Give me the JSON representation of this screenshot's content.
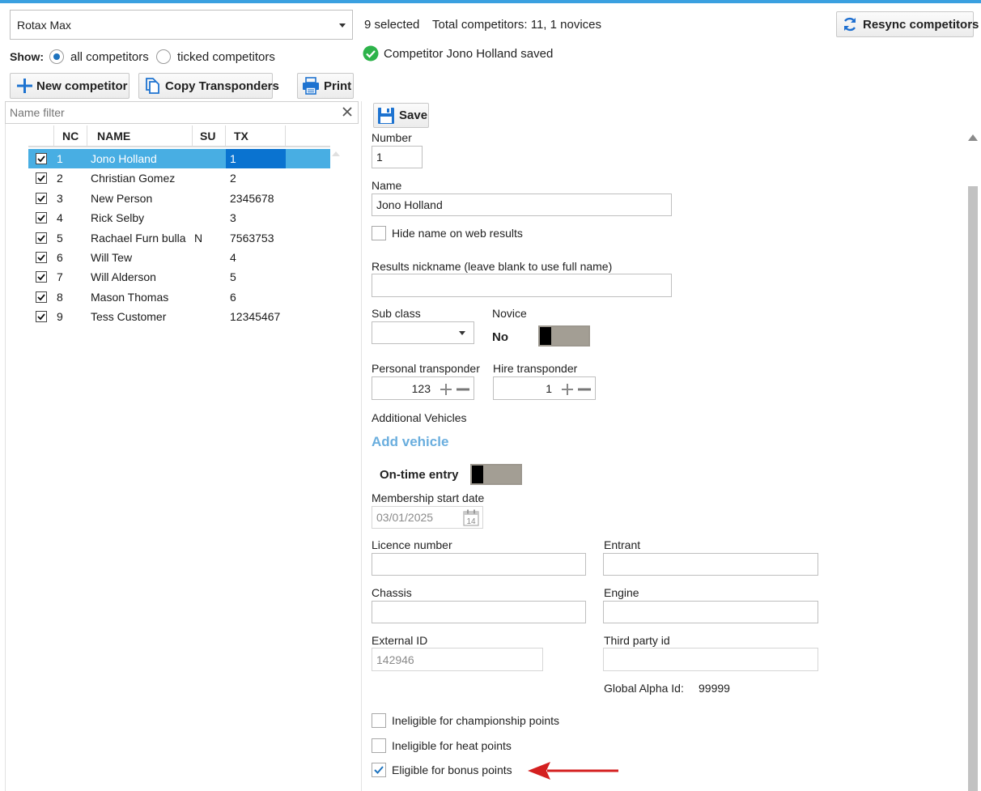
{
  "header": {
    "class_select": "Rotax Max",
    "selected_text": "9 selected",
    "total_text": "Total competitors: 11, 1 novices",
    "resync_label": "Resync competitors",
    "saved_message": "Competitor Jono Holland saved"
  },
  "show": {
    "label": "Show:",
    "all_label": "all competitors",
    "ticked_label": "ticked competitors"
  },
  "toolbar": {
    "new_label": "New competitor",
    "copy_label": "Copy Transponders",
    "print_label": "Print"
  },
  "filter": {
    "placeholder": "Name filter"
  },
  "table": {
    "columns": [
      "NC",
      "NAME",
      "SU",
      "TX"
    ],
    "rows": [
      {
        "num": "1",
        "name": "Jono Holland",
        "su": "",
        "tx": "1"
      },
      {
        "num": "2",
        "name": "Christian Gomez",
        "su": "",
        "tx": "2"
      },
      {
        "num": "3",
        "name": "New Person",
        "su": "",
        "tx": "2345678"
      },
      {
        "num": "4",
        "name": "Rick Selby",
        "su": "",
        "tx": "3"
      },
      {
        "num": "5",
        "name": "Rachael Furn bulla",
        "su": "N",
        "tx": "7563753"
      },
      {
        "num": "6",
        "name": "Will Tew",
        "su": "",
        "tx": "4"
      },
      {
        "num": "7",
        "name": "Will Alderson",
        "su": "",
        "tx": "5"
      },
      {
        "num": "8",
        "name": "Mason Thomas",
        "su": "",
        "tx": "6"
      },
      {
        "num": "9",
        "name": "Tess Customer",
        "su": "",
        "tx": "12345467"
      }
    ]
  },
  "form": {
    "save_label": "Save",
    "number_label": "Number",
    "number_value": "1",
    "name_label": "Name",
    "name_value": "Jono Holland",
    "hide_name_label": "Hide name on web results",
    "nickname_label": "Results nickname (leave blank to use full name)",
    "nickname_value": "",
    "subclass_label": "Sub class",
    "novice_label": "Novice",
    "novice_value": "No",
    "personal_tx_label": "Personal transponder",
    "personal_tx_value": "123",
    "hire_tx_label": "Hire transponder",
    "hire_tx_value": "1",
    "additional_vehicles_label": "Additional Vehicles",
    "add_vehicle_label": "Add vehicle",
    "ontime_label": "On-time entry",
    "membership_label": "Membership start date",
    "membership_value": "03/01/2025",
    "calendar_day": "14",
    "licence_label": "Licence number",
    "entrant_label": "Entrant",
    "chassis_label": "Chassis",
    "engine_label": "Engine",
    "external_id_label": "External ID",
    "external_id_value": "142946",
    "third_party_label": "Third party id",
    "global_alpha_label": "Global Alpha Id:",
    "global_alpha_value": "99999",
    "ineligible_champ_label": "Ineligible for championship points",
    "ineligible_heat_label": "Ineligible for heat points",
    "eligible_bonus_label": "Eligible for bonus points"
  },
  "colors": {
    "selection": "#48aee3",
    "selection_dark": "#0a73d0",
    "accent": "#1e73be",
    "link": "#6aaede",
    "arrow": "#d42020"
  }
}
